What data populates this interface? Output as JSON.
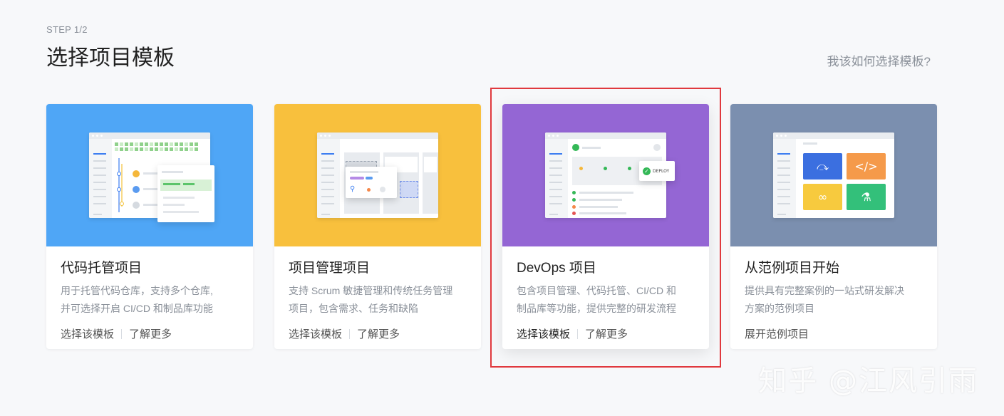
{
  "header": {
    "step": "STEP 1/2",
    "title": "选择项目模板",
    "help_link": "我该如何选择模板?"
  },
  "cards": [
    {
      "title": "代码托管项目",
      "desc_line1": "用于托管代码仓库，支持多个仓库,",
      "desc_line2": "并可选择开启 CI/CD 和制品库功能",
      "action1": "选择该模板",
      "action2": "了解更多",
      "color": "#4fa6f6"
    },
    {
      "title": "项目管理项目",
      "desc_line1": "支持 Scrum 敏捷管理和传统任务管理",
      "desc_line2": "项目，包含需求、任务和缺陷",
      "action1": "选择该模板",
      "action2": "了解更多",
      "color": "#f8c03d"
    },
    {
      "title": "DevOps 项目",
      "desc_line1": "包含项目管理、代码托管、CI/CD 和",
      "desc_line2": "制品库等功能，提供完整的研发流程",
      "action1": "选择该模板",
      "action2": "了解更多",
      "color": "#9466d4",
      "deploy_label": "DEPLOY"
    },
    {
      "title": "从范例项目开始",
      "desc_line1": "提供具有完整案例的一站式研发解决",
      "desc_line2": "方案的范例项目",
      "action1": "展开范例项目",
      "color": "#7b8faf",
      "tile_icons": [
        "rocket-icon",
        "code-icon",
        "infinity-icon",
        "flask-icon"
      ],
      "tile_colors": [
        "#3b6fe0",
        "#f59a4a",
        "#f7ca3e",
        "#33c07a"
      ]
    }
  ],
  "watermark": "知乎 @江风引雨"
}
